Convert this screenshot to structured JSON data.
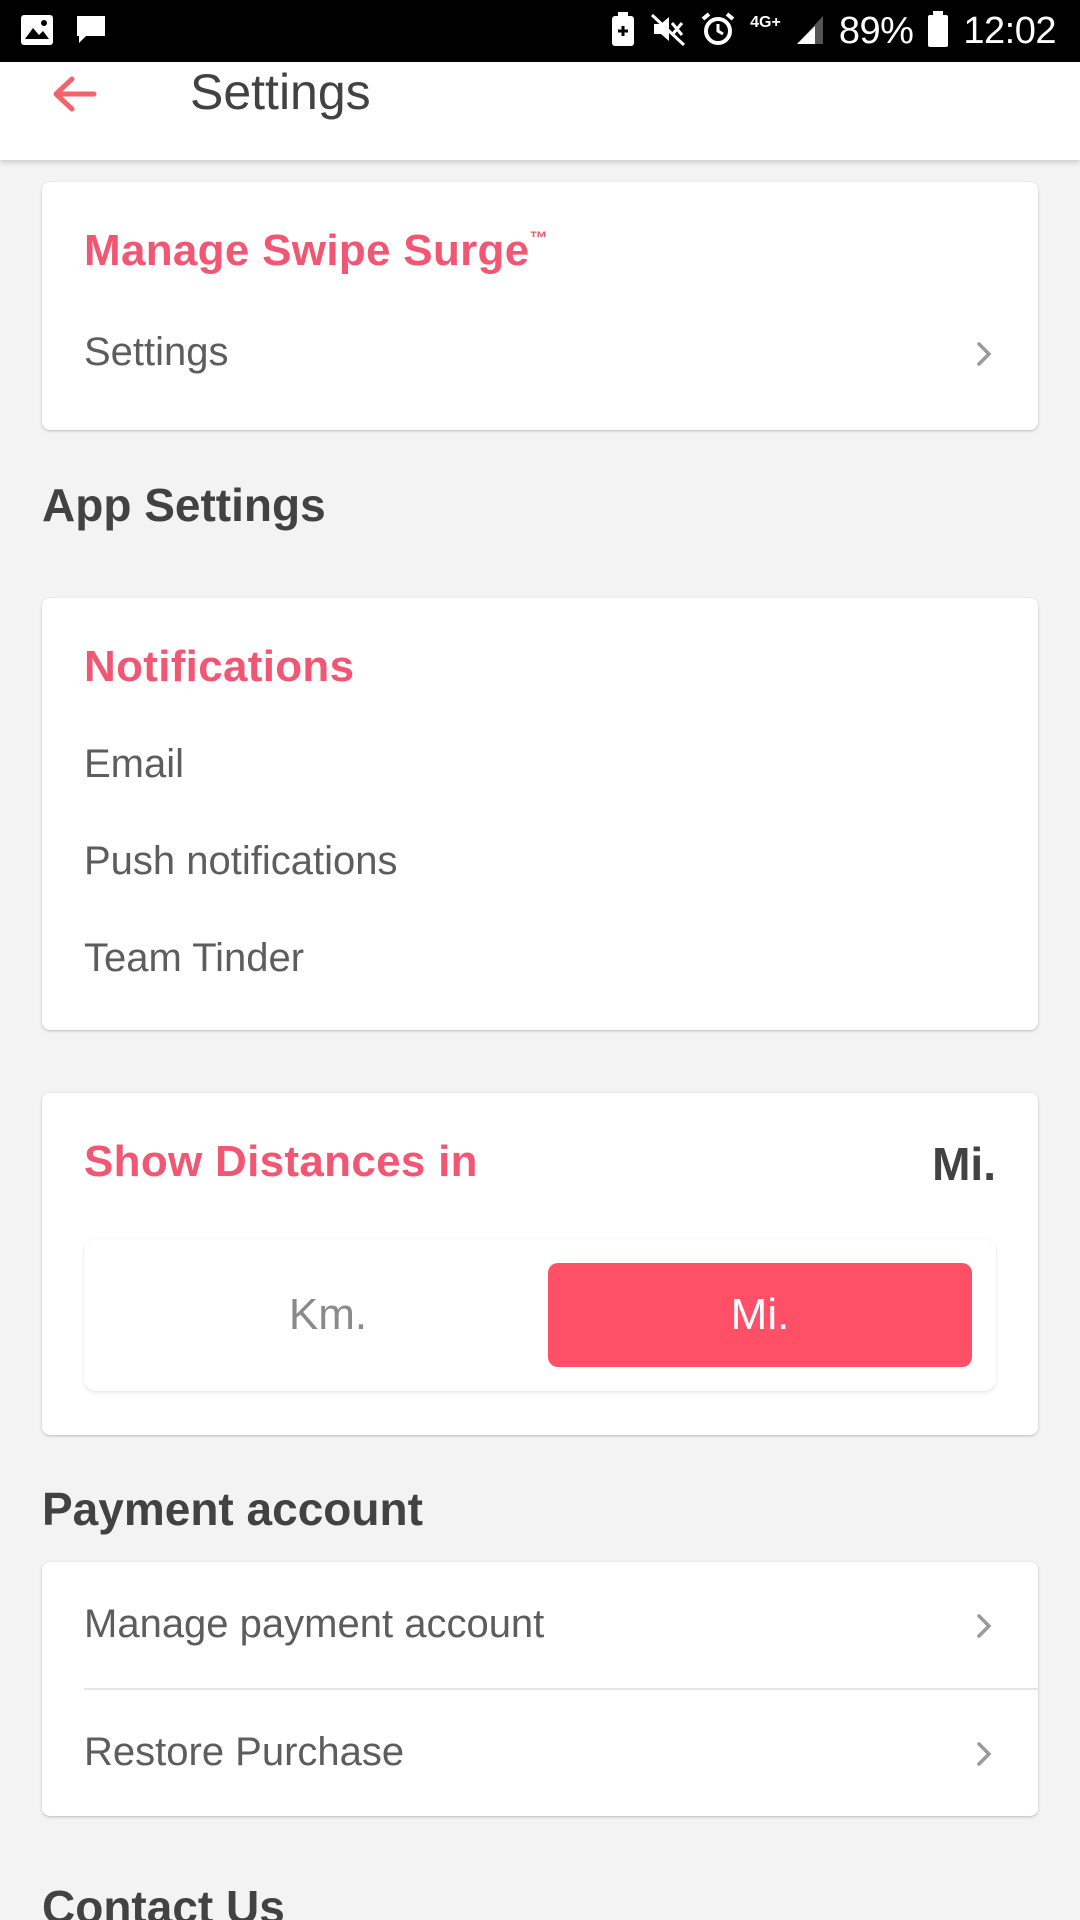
{
  "status_bar": {
    "battery_percent": "89%",
    "time": "12:02",
    "network": "4G+"
  },
  "app_bar": {
    "title": "Settings"
  },
  "swipe_surge": {
    "title": "Manage Swipe Surge",
    "trademark": "™",
    "row_label": "Settings"
  },
  "app_settings": {
    "heading": "App Settings"
  },
  "notifications": {
    "title": "Notifications",
    "items": [
      "Email",
      "Push notifications",
      "Team Tinder"
    ]
  },
  "distances": {
    "title": "Show Distances in",
    "current_value": "Mi.",
    "options": [
      "Km.",
      "Mi."
    ],
    "selected": "Mi."
  },
  "payment": {
    "heading": "Payment account",
    "items": [
      "Manage payment account",
      "Restore Purchase"
    ]
  },
  "contact": {
    "heading": "Contact Us"
  },
  "colors": {
    "accent": "#f15772",
    "selected_segment": "#ff5068",
    "background": "#f3f3f3"
  }
}
